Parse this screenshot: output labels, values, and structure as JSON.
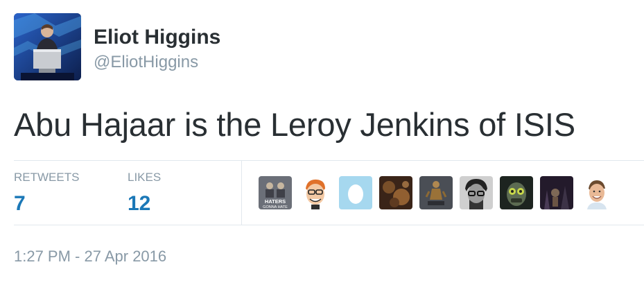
{
  "author": {
    "display_name": "Eliot Higgins",
    "screen_name": "@EliotHiggins",
    "avatar_icon": "speaker-at-podium-avatar"
  },
  "tweet": {
    "text": "Abu Hajaar is the Leroy Jenkins of ISIS"
  },
  "stats": {
    "retweets_label": "RETWEETS",
    "retweets_value": "7",
    "likes_label": "LIKES",
    "likes_value": "12"
  },
  "likers": [
    {
      "icon": "haters-gonna-hate-avatar",
      "text": "HATERS GONNA HATE"
    },
    {
      "icon": "cartoon-face-avatar"
    },
    {
      "icon": "default-egg-avatar"
    },
    {
      "icon": "dark-photo-avatar"
    },
    {
      "icon": "figurine-avatar"
    },
    {
      "icon": "glasses-man-avatar"
    },
    {
      "icon": "masked-face-avatar"
    },
    {
      "icon": "night-scene-avatar"
    },
    {
      "icon": "smiling-man-avatar"
    }
  ],
  "timestamp": "1:27 PM - 27 Apr 2016",
  "colors": {
    "text": "#292f33",
    "muted": "#8899a6",
    "stat_value": "#1b78b7",
    "divider": "#e1e8ed"
  }
}
